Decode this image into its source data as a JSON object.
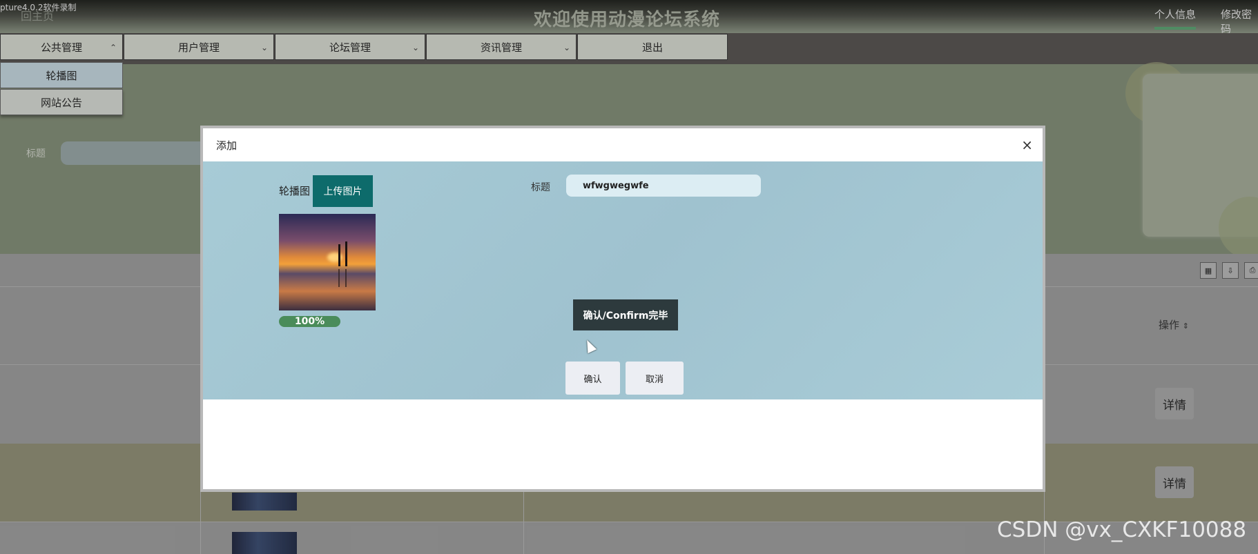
{
  "recording_label": "pture4.0.2软件录制",
  "home_link": "回主页",
  "site_title": "欢迎使用动漫论坛系统",
  "top_links": [
    "个人信息",
    "修改密码"
  ],
  "nav": [
    {
      "label": "公共管理",
      "chevron": "^"
    },
    {
      "label": "用户管理",
      "chevron": "v"
    },
    {
      "label": "论坛管理",
      "chevron": "v"
    },
    {
      "label": "资讯管理",
      "chevron": "v"
    },
    {
      "label": "退出"
    }
  ],
  "dropdown": [
    "轮播图",
    "网站公告"
  ],
  "search": {
    "label": "标题"
  },
  "table": {
    "op_header": "操作",
    "sort_icon": "sort-icon",
    "detail_label": "详情"
  },
  "watermark": "CSDN @vx_CXKF10088",
  "dialog": {
    "title": "添加",
    "close": "×",
    "carousel_label": "轮播图",
    "upload_button": "上传图片",
    "progress": "100%",
    "progress_value": 1.0,
    "title_label": "标题",
    "title_value": "wfwgwegwfe",
    "confirm_done": "确认/Confirm完毕",
    "ok": "确认",
    "cancel": "取消"
  },
  "colors": {
    "upload_button": "#0d6b6b",
    "confirm_done": "#2d3a3d",
    "progress": "#4a8c5a",
    "nav_bar": "#5b5654"
  }
}
